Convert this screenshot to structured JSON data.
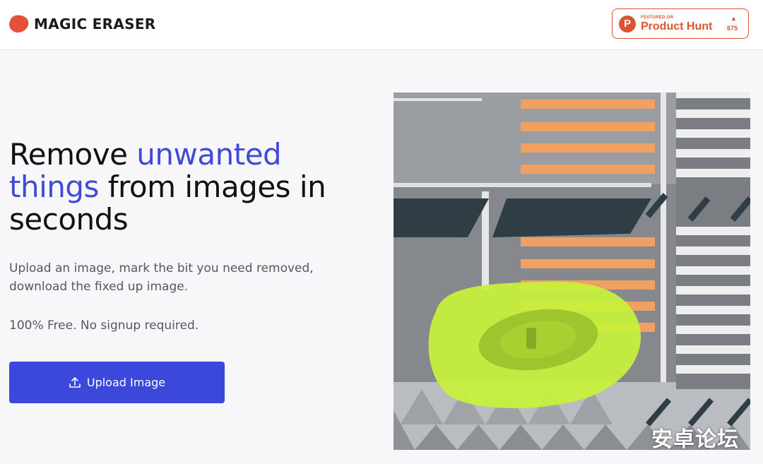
{
  "header": {
    "brand": "MAGIC ERASER",
    "product_hunt": {
      "featured": "FEATURED ON",
      "name": "Product Hunt",
      "logo_letter": "P",
      "upvote_arrow": "▲",
      "count": "675"
    }
  },
  "hero": {
    "headline_part1": "Remove ",
    "headline_accent": "unwanted things",
    "headline_part2": " from images in seconds",
    "description": "Upload an image, mark the bit you need removed, download the fixed up image.",
    "pricing_note": "100% Free. No signup required.",
    "upload_label": "Upload Image"
  },
  "image": {
    "alt": "Aerial view of a car on a crosswalk highlighted for removal"
  },
  "watermark": "安卓论坛",
  "colors": {
    "accent": "#3f4ad9",
    "button": "#3c48dc",
    "brand_red": "#e4513a",
    "product_hunt": "#da552f",
    "highlight_mask": "#c8f23a"
  },
  "icons": {
    "logo": "blob-logo-icon",
    "upload": "upload-icon"
  }
}
